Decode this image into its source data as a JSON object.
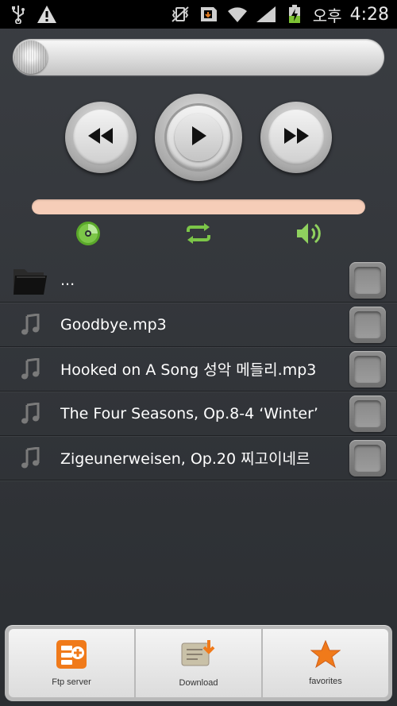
{
  "statusbar": {
    "ampm": "오후",
    "time": "4:28",
    "icons": [
      "usb-icon",
      "warning-icon",
      "vibrate-mute-icon",
      "sim-icon",
      "wifi-icon",
      "signal-icon",
      "battery-charging-icon"
    ]
  },
  "player": {
    "seek_progress": 0,
    "volume_level": 1.0,
    "controls": [
      "rewind-icon",
      "play-icon",
      "fast-forward-icon"
    ],
    "modes": [
      "cd-icon",
      "repeat-icon",
      "volume-icon"
    ]
  },
  "files": [
    {
      "icon": "folder-icon",
      "label": "..."
    },
    {
      "icon": "music-note-icon",
      "label": "Goodbye.mp3"
    },
    {
      "icon": "music-note-icon",
      "label": "Hooked on A Song 성악 메들리.mp3"
    },
    {
      "icon": "music-note-icon",
      "label": "The Four Seasons, Op.8-4 ‘Winter’"
    },
    {
      "icon": "music-note-icon",
      "label": "Zigeunerweisen, Op.20 찌고이네르"
    }
  ],
  "tabs": [
    {
      "label": "Ftp server",
      "icon": "ftp-server-icon"
    },
    {
      "label": "Download",
      "icon": "download-icon"
    },
    {
      "label": "favorites",
      "icon": "star-icon"
    }
  ]
}
